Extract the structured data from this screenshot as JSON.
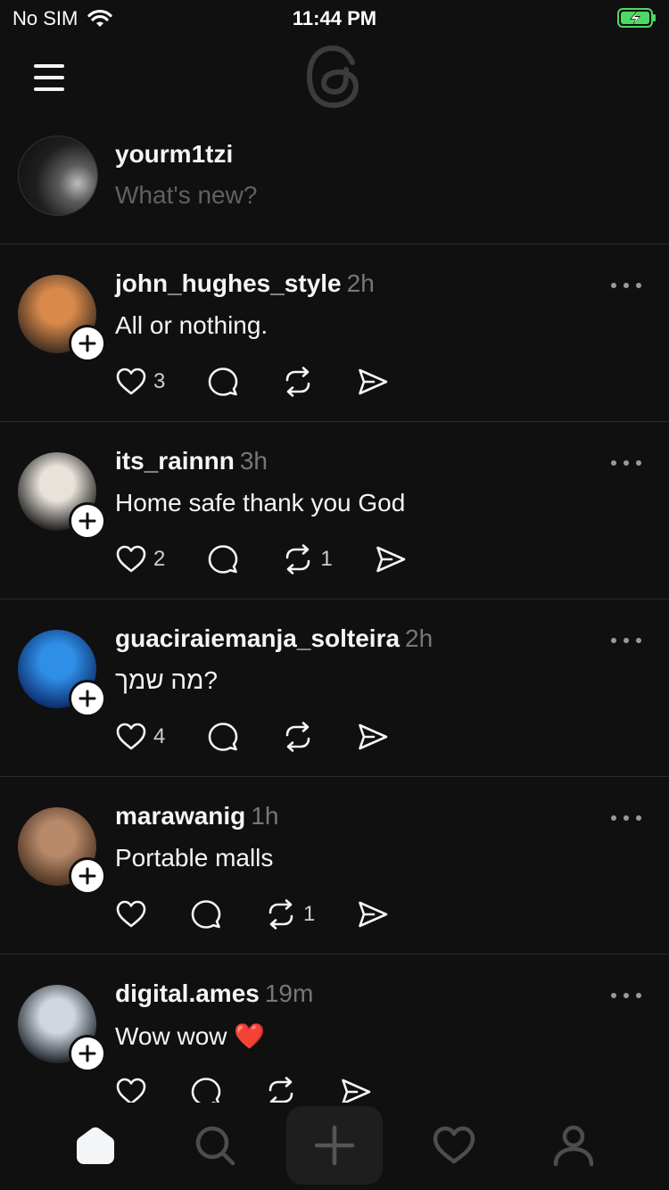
{
  "status_bar": {
    "carrier": "No SIM",
    "time": "11:44 PM"
  },
  "composer": {
    "username": "yourm1tzi",
    "placeholder": "What's new?"
  },
  "posts": [
    {
      "username": "john_hughes_style",
      "time": "2h",
      "text": "All or nothing.",
      "likes": "3",
      "reposts": "",
      "avatar_colors": [
        "#d98a4a",
        "#3a2a20"
      ]
    },
    {
      "username": "its_rainnn",
      "time": "3h",
      "text": "Home safe thank you God",
      "likes": "2",
      "reposts": "1",
      "avatar_colors": [
        "#e8e2da",
        "#1a1a1a"
      ]
    },
    {
      "username": "guaciraiemanja_solteira",
      "time": "2h",
      "text": "מה שמך?",
      "likes": "4",
      "reposts": "",
      "avatar_colors": [
        "#2f8fe6",
        "#0b2a6b"
      ]
    },
    {
      "username": "marawanig",
      "time": "1h",
      "text": "Portable malls",
      "likes": "",
      "reposts": "1",
      "avatar_colors": [
        "#b88a6a",
        "#4a3020"
      ]
    },
    {
      "username": "digital.ames",
      "time": "19m",
      "text": "Wow wow ❤️",
      "likes": "",
      "reposts": "",
      "avatar_colors": [
        "#cfd6df",
        "#1a1f26"
      ]
    }
  ],
  "icons": {
    "menu": "hamburger-menu-icon",
    "logo": "threads-logo",
    "like": "heart-icon",
    "reply": "speech-bubble-icon",
    "repost": "repost-icon",
    "share": "send-icon",
    "more": "ellipsis-icon",
    "follow": "plus-icon",
    "tabs": [
      "home-icon",
      "search-icon",
      "create-icon",
      "activity-heart-icon",
      "profile-icon"
    ]
  },
  "colors": {
    "background": "#101010",
    "text": "#f3f5f7",
    "muted": "#777777",
    "battery": "#4cd964",
    "heart_emoji": "#e0102b"
  }
}
